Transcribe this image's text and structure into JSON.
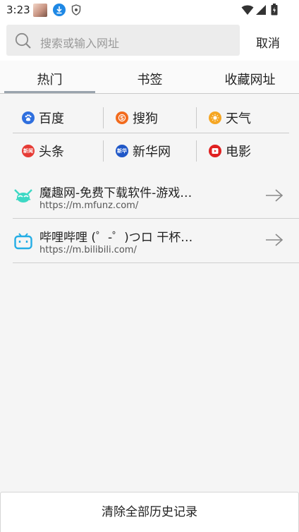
{
  "status_bar": {
    "time": "3:23",
    "icons": [
      "avatar-thumbnail",
      "download-icon",
      "shield-icon",
      "wifi-icon",
      "signal-icon",
      "battery-icon"
    ]
  },
  "search": {
    "placeholder": "搜索或输入网址",
    "cancel_label": "取消",
    "icon": "search-icon"
  },
  "tabs": [
    {
      "label": "热门",
      "active": true
    },
    {
      "label": "书签",
      "active": false
    },
    {
      "label": "收藏网址",
      "active": false
    }
  ],
  "quick_links": [
    {
      "label": "百度",
      "icon": "baidu-icon",
      "color": "#2f6fde"
    },
    {
      "label": "搜狗",
      "icon": "sogou-icon",
      "color": "#f26b1d"
    },
    {
      "label": "天气",
      "icon": "weather-sun-icon",
      "color": "#f5a623"
    },
    {
      "label": "头条",
      "icon": "toutiao-icon",
      "color": "#e63b35",
      "icon_text": "新闻"
    },
    {
      "label": "新华网",
      "icon": "xinhua-icon",
      "color": "#1f57c7",
      "icon_text": "新华"
    },
    {
      "label": "电影",
      "icon": "movie-play-icon",
      "color": "#e02020"
    }
  ],
  "history": [
    {
      "title": "魔趣网-免费下载软件-游戏…",
      "url": "https://m.mfunz.com/",
      "icon": "mfunz-icon",
      "color": "#3dd8c4"
    },
    {
      "title": "哔哩哔哩 (゜-゜)つロ 干杯…",
      "url": "https://m.bilibili.com/",
      "icon": "bilibili-icon",
      "color": "#23ade5"
    }
  ],
  "clear_history_label": "清除全部历史记录",
  "colors": {
    "background": "#f5f5f5",
    "tab_underline": "#9aa3ad",
    "divider": "#c9c9c9",
    "download_blue": "#1e88e5"
  }
}
